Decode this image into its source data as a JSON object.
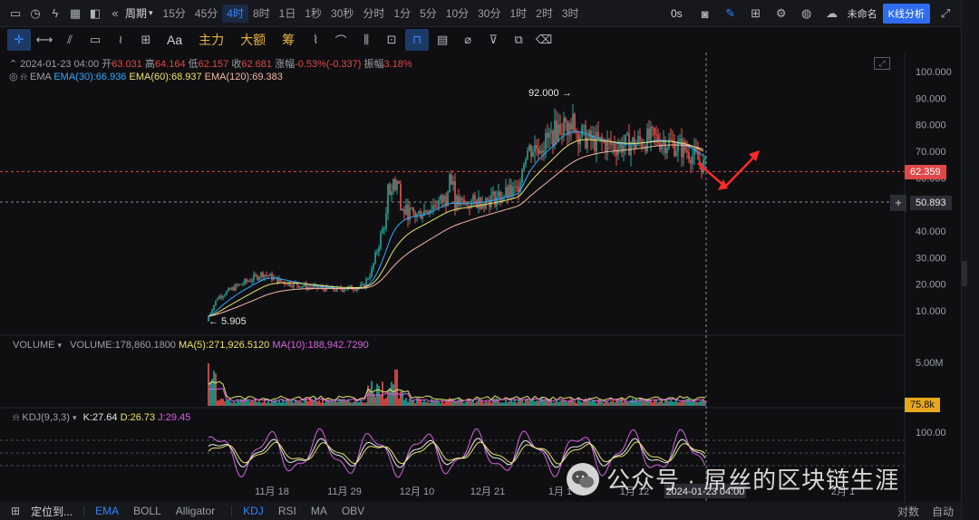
{
  "topbar": {
    "period_label": "周期",
    "intervals": [
      "15分",
      "45分",
      "4时",
      "8时",
      "1日",
      "1秒",
      "30秒",
      "分时",
      "1分",
      "5分",
      "10分",
      "30分",
      "1时",
      "2时",
      "3时"
    ],
    "active_interval": "4时",
    "countdown": "0s",
    "layout_name": "未命名",
    "kline_button": "K线分析"
  },
  "drawbar": {
    "labels": {
      "aa": "Aa",
      "main_force": "主力",
      "large_amount": "大额",
      "chip": "筹"
    }
  },
  "legend": {
    "date": "2024-01-23 04:00",
    "open_label": "开",
    "open": "63.031",
    "high_label": "高",
    "high": "64.164",
    "low_label": "低",
    "low": "62.157",
    "close_label": "收",
    "close": "62.681",
    "change_label": "涨幅",
    "change": "-0.53%(-0.337)",
    "amp_label": "振幅",
    "amp": "3.18%",
    "ema_label": "EMA",
    "ema30": "EMA(30):66.936",
    "ema60": "EMA(60):68.937",
    "ema120": "EMA(120):69.383"
  },
  "price_axis": {
    "ticks": [
      "100.000",
      "90.000",
      "80.000",
      "70.000",
      "60.000",
      "50.000",
      "40.000",
      "30.000",
      "20.000",
      "10.000"
    ],
    "current_price": "62.359",
    "crosshair_price": "50.893",
    "high_marker": "92.000",
    "low_marker": "5.905"
  },
  "volume": {
    "title": "VOLUME",
    "value": "VOLUME:178,860.1800",
    "ma5": "MA(5):271,926.5120",
    "ma10": "MA(10):188,942.7290",
    "axis_label": "5.00M",
    "current": "75.8k"
  },
  "kdj": {
    "title": "KDJ(9,3,3)",
    "k": "K:27.64",
    "d": "D:26.73",
    "j": "J:29.45",
    "axis_label": "100.00"
  },
  "time_axis": {
    "labels": [
      "11月 18",
      "11月 29",
      "12月 10",
      "12月 21",
      "1月 1",
      "1月 12",
      "2月 1"
    ],
    "crosshair_time": "2024-01-23 04:00"
  },
  "bottombar": {
    "locate": "定位到...",
    "indicators": [
      "EMA",
      "BOLL",
      "Alligator",
      "KDJ",
      "RSI",
      "MA",
      "OBV"
    ],
    "active": [
      "EMA",
      "KDJ"
    ],
    "log_label": "对数",
    "auto_label": "自动"
  },
  "watermark": {
    "text": "公众号 · 屌丝的区块链生涯"
  },
  "colors": {
    "up": "#26a69a",
    "down": "#ef5350",
    "ema30": "#2ea8ff",
    "ema60": "#e9e36a",
    "ema120": "#f2b7a4",
    "accent": "#2f86ff"
  }
}
